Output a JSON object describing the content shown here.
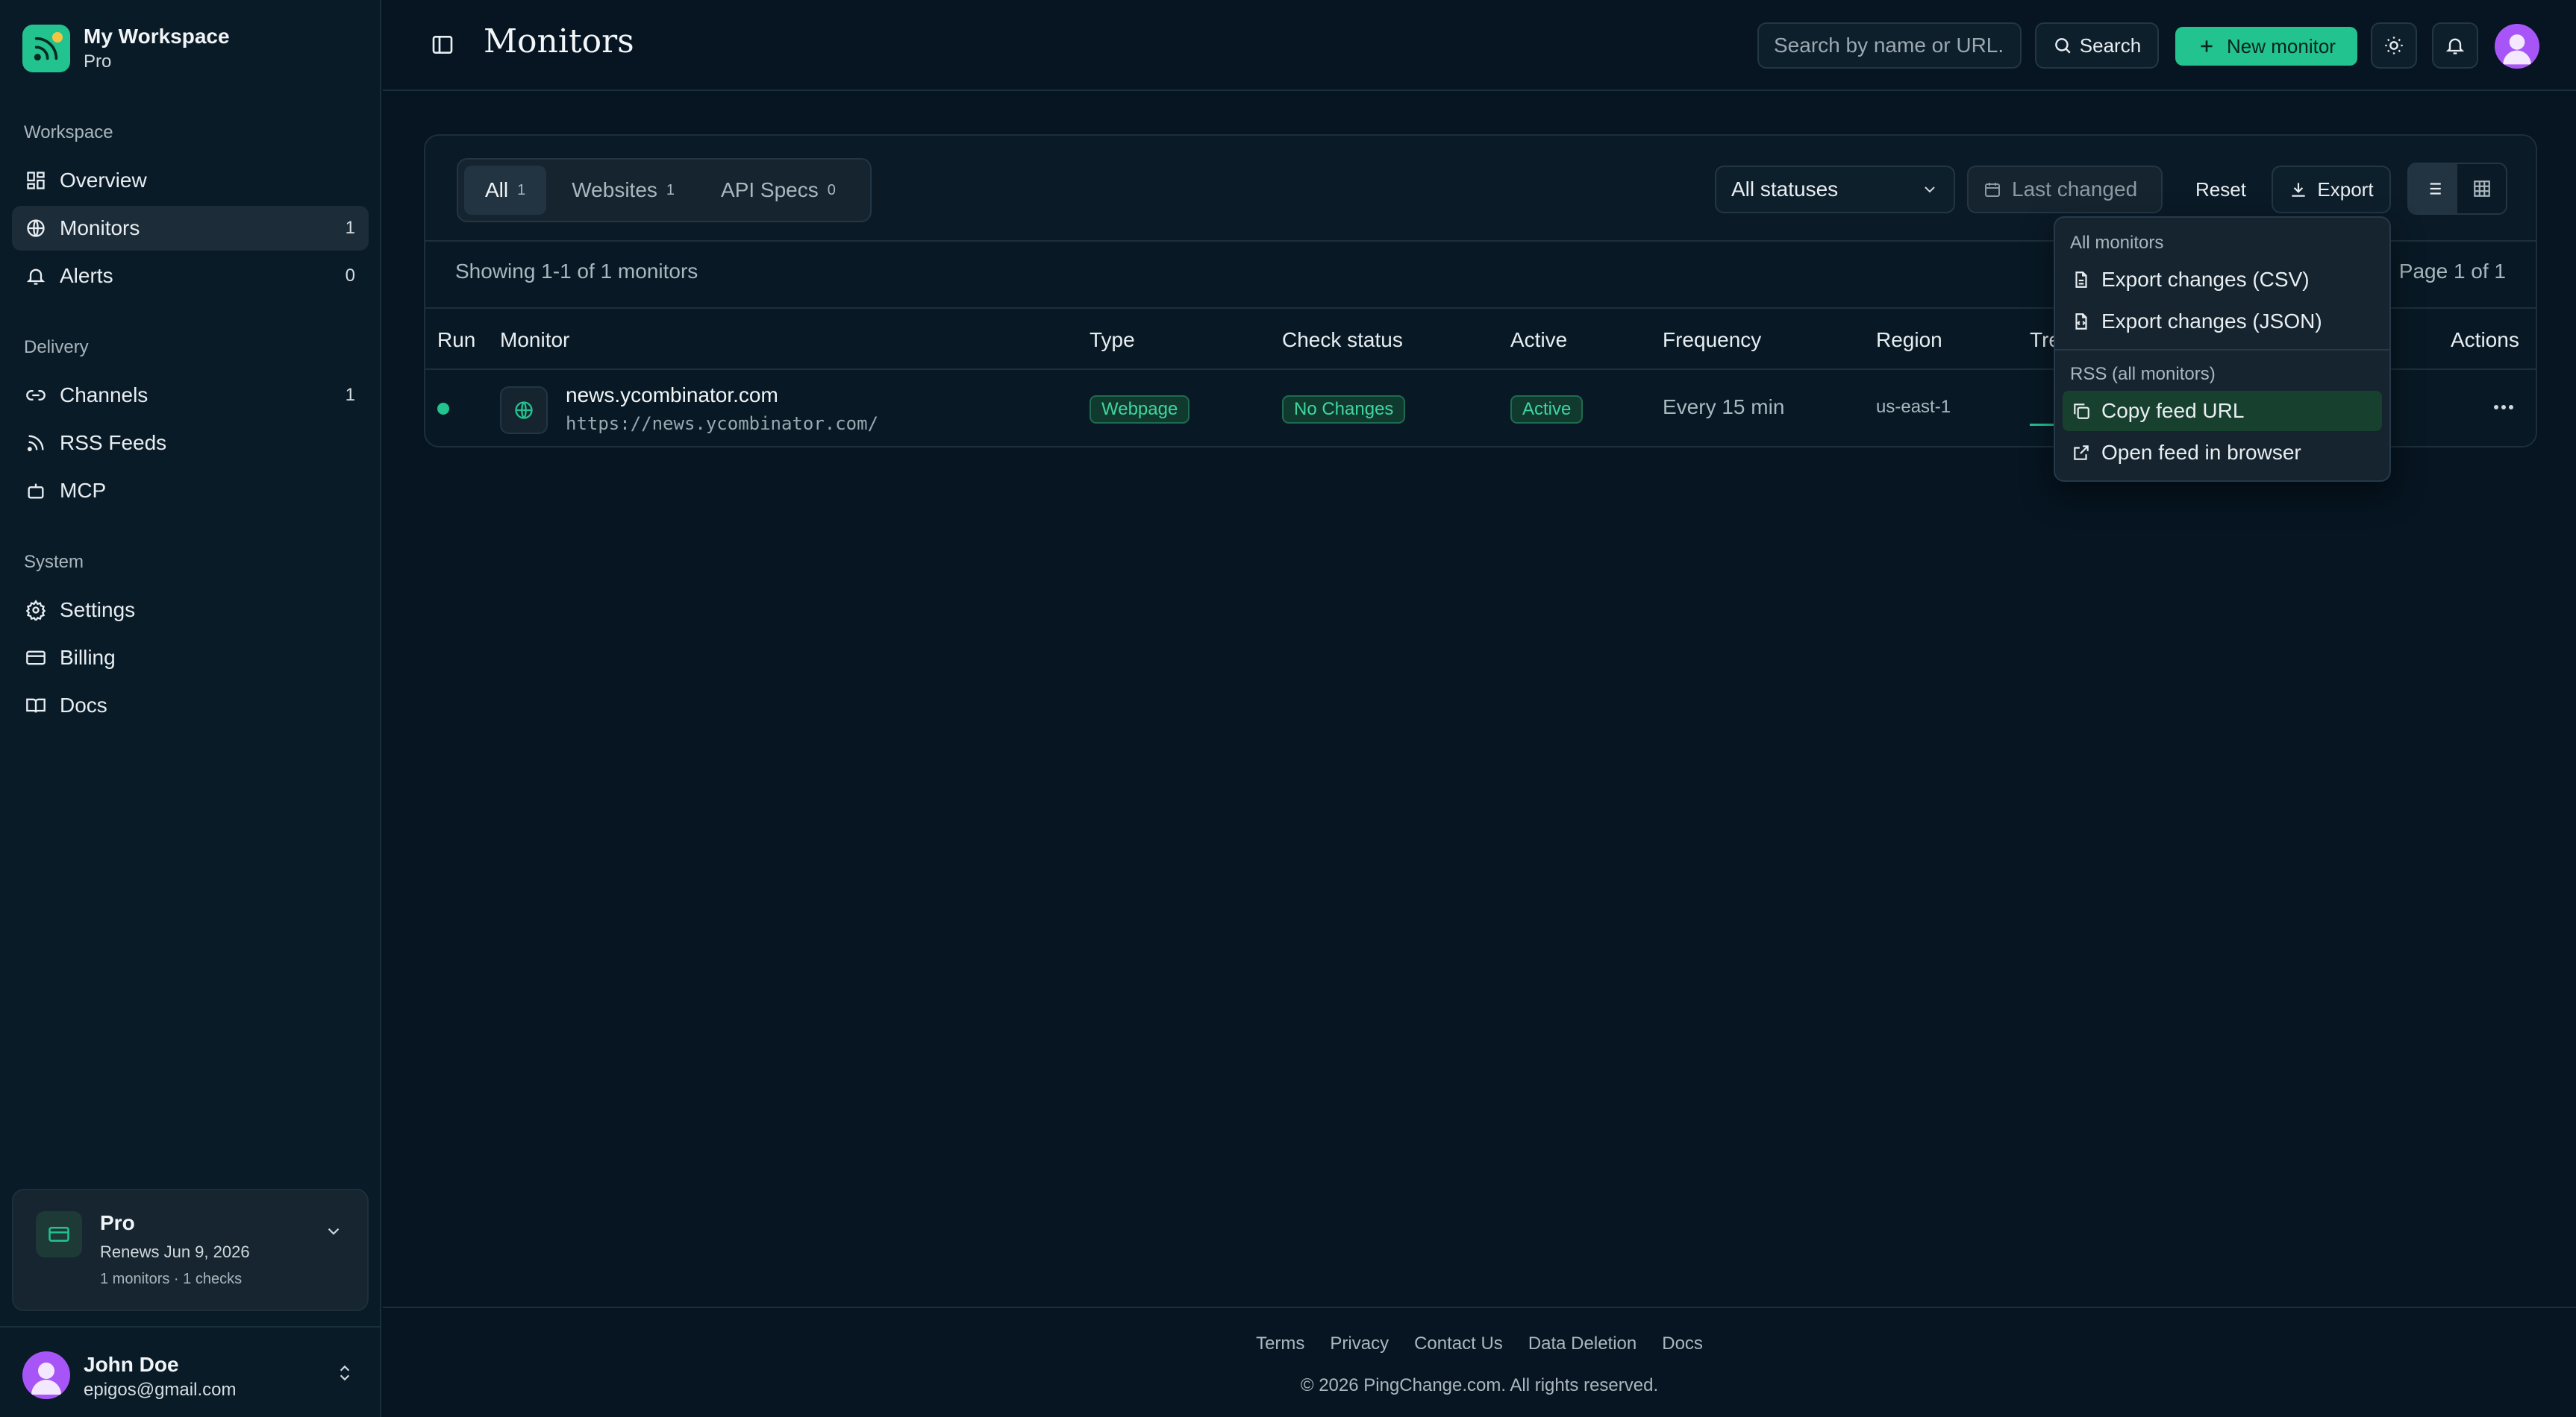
{
  "workspace": {
    "name": "My Workspace",
    "plan": "Pro"
  },
  "sidebar": {
    "sections": [
      {
        "label": "Workspace",
        "items": [
          {
            "label": "Overview",
            "icon": "dashboard-icon",
            "count": ""
          },
          {
            "label": "Monitors",
            "icon": "globe-icon",
            "count": "1",
            "active": true
          },
          {
            "label": "Alerts",
            "icon": "bell-icon",
            "count": "0"
          }
        ]
      },
      {
        "label": "Delivery",
        "items": [
          {
            "label": "Channels",
            "icon": "link-icon",
            "count": "1"
          },
          {
            "label": "RSS Feeds",
            "icon": "rss-icon",
            "count": ""
          },
          {
            "label": "MCP",
            "icon": "robot-icon",
            "count": ""
          }
        ]
      },
      {
        "label": "System",
        "items": [
          {
            "label": "Settings",
            "icon": "gear-icon",
            "count": ""
          },
          {
            "label": "Billing",
            "icon": "credit-card-icon",
            "count": ""
          },
          {
            "label": "Docs",
            "icon": "book-icon",
            "count": ""
          }
        ]
      }
    ]
  },
  "plan_card": {
    "title": "Pro",
    "renews": "Renews Jun 9, 2026",
    "stats": "1 monitors · 1 checks"
  },
  "user": {
    "name": "John Doe",
    "email": "epigos@gmail.com"
  },
  "topbar": {
    "title": "Monitors",
    "search_placeholder": "Search by name or URL...",
    "search_label": "Search",
    "new_monitor_label": "New monitor"
  },
  "filters": {
    "tabs": [
      {
        "label": "All",
        "count": "1",
        "active": true
      },
      {
        "label": "Websites",
        "count": "1"
      },
      {
        "label": "API Specs",
        "count": "0"
      }
    ],
    "status_value": "All statuses",
    "date_label": "Last changed",
    "reset_label": "Reset",
    "export_label": "Export"
  },
  "summary": {
    "showing": "Showing 1-1 of 1 monitors",
    "page": "Page 1 of 1"
  },
  "table": {
    "headers": {
      "run": "Run",
      "monitor": "Monitor",
      "type": "Type",
      "check_status": "Check status",
      "active": "Active",
      "frequency": "Frequency",
      "region": "Region",
      "trend": "Tre",
      "actions": "Actions"
    },
    "rows": [
      {
        "name": "news.ycombinator.com",
        "url": "https://news.ycombinator.com/",
        "type": "Webpage",
        "check_status": "No Changes",
        "active": "Active",
        "frequency": "Every 15 min",
        "region": "us-east-1"
      }
    ]
  },
  "export_menu": {
    "section1": "All monitors",
    "items1": [
      "Export changes (CSV)",
      "Export changes (JSON)"
    ],
    "section2": "RSS (all monitors)",
    "items2": [
      "Copy feed URL",
      "Open feed in browser"
    ],
    "highlighted": "Copy feed URL"
  },
  "footer": {
    "links": [
      "Terms",
      "Privacy",
      "Contact Us",
      "Data Deletion",
      "Docs"
    ],
    "copyright": "© 2026 PingChange.com. All rights reserved."
  },
  "colors": {
    "accent": "#22c38e",
    "background": "#061521",
    "sidebar": "#0a1b28",
    "avatar": "#a855f7"
  }
}
